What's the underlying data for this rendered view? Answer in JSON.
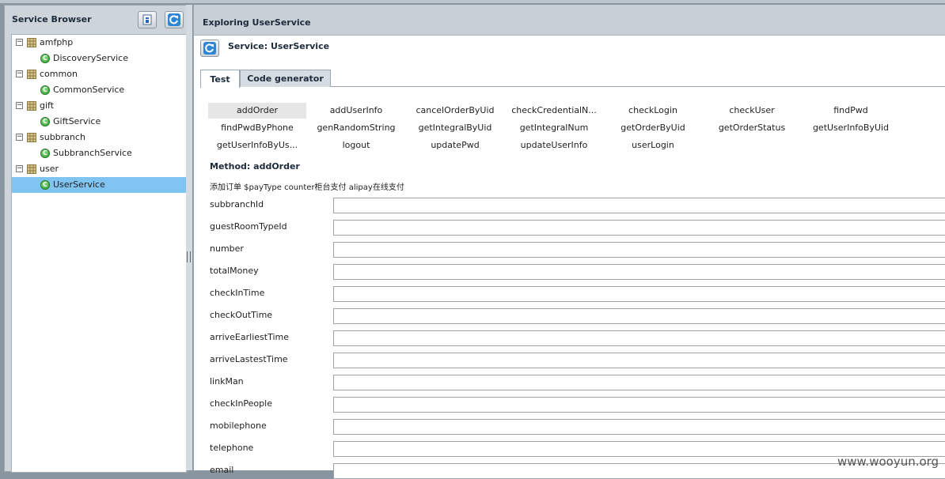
{
  "left_panel": {
    "title": "Service Browser",
    "tree": [
      {
        "label": "amfphp",
        "expander": "⊟",
        "children": [
          {
            "label": "DiscoveryService"
          }
        ]
      },
      {
        "label": "common",
        "expander": "⊟",
        "children": [
          {
            "label": "CommonService"
          }
        ]
      },
      {
        "label": "gift",
        "expander": "⊟",
        "children": [
          {
            "label": "GiftService"
          }
        ]
      },
      {
        "label": "subbranch",
        "expander": "⊟",
        "children": [
          {
            "label": "SubbranchService"
          }
        ]
      },
      {
        "label": "user",
        "expander": "⊟",
        "children": [
          {
            "label": "UserService",
            "selected": true
          }
        ]
      }
    ]
  },
  "main": {
    "title": "Exploring UserService",
    "service_label": "Service: UserService",
    "tabs": [
      {
        "label": "Test",
        "active": true
      },
      {
        "label": "Code generator",
        "active": false
      }
    ],
    "methods": [
      "addOrder",
      "addUserInfo",
      "cancelOrderByUid",
      "checkCredentialN...",
      "checkLogin",
      "checkUser",
      "findPwd",
      "findPwdByPhone",
      "genRandomString",
      "getIntegralByUid",
      "getIntegralNum",
      "getOrderByUid",
      "getOrderStatus",
      "getUserInfoByUid",
      "getUserInfoByUs...",
      "logout",
      "updatePwd",
      "updateUserInfo",
      "userLogin"
    ],
    "selected_method": "addOrder",
    "method_title": "Method: addOrder",
    "method_description": "添加订单 $payType counter柜台支付 alipay在线支付",
    "params": [
      {
        "name": "subbranchId",
        "value": ""
      },
      {
        "name": "guestRoomTypeId",
        "value": ""
      },
      {
        "name": "number",
        "value": ""
      },
      {
        "name": "totalMoney",
        "value": ""
      },
      {
        "name": "checkInTime",
        "value": ""
      },
      {
        "name": "checkOutTime",
        "value": ""
      },
      {
        "name": "arriveEarliestTime",
        "value": ""
      },
      {
        "name": "arriveLastestTime",
        "value": ""
      },
      {
        "name": "linkMan",
        "value": ""
      },
      {
        "name": "checkInPeople",
        "value": ""
      },
      {
        "name": "mobilephone",
        "value": ""
      },
      {
        "name": "telephone",
        "value": ""
      },
      {
        "name": "email",
        "value": ""
      }
    ]
  },
  "watermark": "www.wooyun.org",
  "colors": {
    "selection": "#80c4f2",
    "panel": "#cdd5db",
    "header": "#c7d0d7"
  }
}
